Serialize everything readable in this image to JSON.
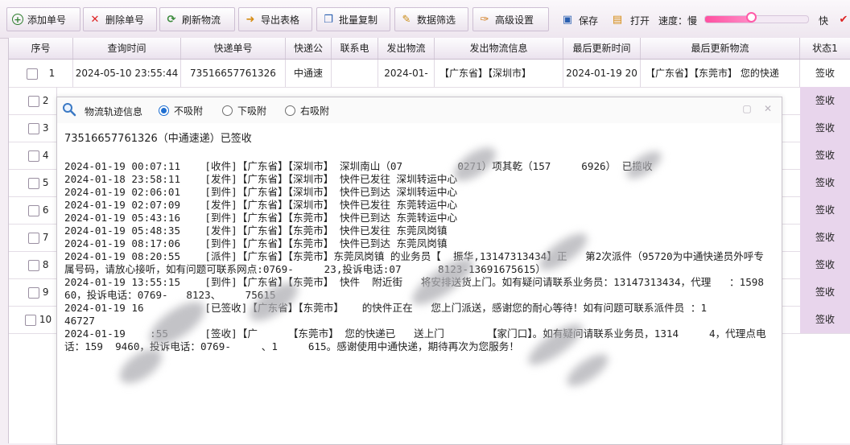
{
  "toolbar": {
    "buttons": [
      {
        "label": "添加单号",
        "icon": "+",
        "color": "#2f7f2f"
      },
      {
        "label": "删除单号",
        "icon": "✕",
        "color": "#d22"
      },
      {
        "label": "刷新物流",
        "icon": "⟳",
        "color": "#3a8a3a"
      },
      {
        "label": "导出表格",
        "icon": "➜",
        "color": "#d58b12"
      },
      {
        "label": "批量复制",
        "icon": "❐",
        "color": "#2a5fb0"
      },
      {
        "label": "数据筛选",
        "icon": "✎",
        "color": "#c98a12"
      },
      {
        "label": "高级设置",
        "icon": "✑",
        "color": "#d17b1a"
      }
    ],
    "save_label": "保存",
    "open_label": "打开",
    "speed_label": "速度：慢",
    "speed_fast": "快",
    "speed_value": 0.45
  },
  "grid": {
    "columns": [
      "序号",
      "查询时间",
      "快递单号",
      "快递公",
      "联系电",
      "发出物流",
      "发出物流信息",
      "最后更新时间",
      "最后更新物流",
      "状态1"
    ],
    "rows": [
      {
        "no": "1",
        "query_time": "2024-05-10 23:55:44",
        "tracking": "73516657761326",
        "company": "中通速",
        "phone": "",
        "sent": "2024-01-",
        "sent_info": "【广东省】【深圳市】",
        "last_time": "2024-01-19 20",
        "last_info": "【广东省】【东莞市】 您的快递",
        "status": "签收"
      },
      {
        "no": "2",
        "status": "签收"
      },
      {
        "no": "3",
        "status": "签收"
      },
      {
        "no": "4",
        "status": "签收"
      },
      {
        "no": "5",
        "status": "签收"
      },
      {
        "no": "6",
        "status": "签收"
      },
      {
        "no": "7",
        "status": "签收"
      },
      {
        "no": "8",
        "status": "签收"
      },
      {
        "no": "9",
        "status": "签收"
      },
      {
        "no": "10",
        "status": "签收"
      }
    ]
  },
  "popup": {
    "title": "物流轨迹信息",
    "radios": [
      {
        "label": "不吸附",
        "checked": true
      },
      {
        "label": "下吸附",
        "checked": false
      },
      {
        "label": "右吸附",
        "checked": false
      }
    ],
    "header_line": "73516657761326（中通速递）已签收",
    "log_lines": [
      "2024-01-19 00:07:11    [收件]【广东省】【深圳市】 深圳南山（07         0271）项其乾（157     6926） 已揽收",
      "2024-01-18 23:58:11    [发件]【广东省】【深圳市】 快件已发往 深圳转运中心",
      "2024-01-19 02:06:01    [到件]【广东省】【深圳市】 快件已到达 深圳转运中心",
      "2024-01-19 02:07:09    [发件]【广东省】【深圳市】 快件已发往 东莞转运中心",
      "2024-01-19 05:43:16    [到件]【广东省】【东莞市】 快件已到达 东莞转运中心",
      "2024-01-19 05:48:35    [发件]【广东省】【东莞市】 快件已发往 东莞凤岗镇",
      "2024-01-19 08:17:06    [到件]【广东省】【东莞市】 快件已到达 东莞凤岗镇",
      "2024-01-19 08:20:55    [派件]【广东省】【东莞市】东莞凤岗镇 的业务员【  振华,13147313434】正   第2次派件（95720为中通快递员外呼专属号码，请放心接听，如有问题可联系网点:0769-     23,投诉电话:07      8123-13691675615）",
      "2024-01-19 13:55:15    [到件]【广东省】【东莞市】 快件  附近街   将安排送货上门。如有疑问请联系业务员：13147313434，代理   ：1598   60，投诉电话：0769-   8123、    75615",
      "2024-01-19 16          [已签收]【广东省】【东莞市】   的快件正在   您上门派送，感谢您的耐心等待！如有问题可联系派件员 ：1      46727",
      "2024-01-19    :55      [签收]【广     【东莞市】 您的快递已   送上门       【家门口】。如有疑问请联系业务员，1314     4，代理点电话：159  9460，投诉电话：0769-     、1     615。感谢使用中通快递，期待再次为您服务！"
    ]
  }
}
